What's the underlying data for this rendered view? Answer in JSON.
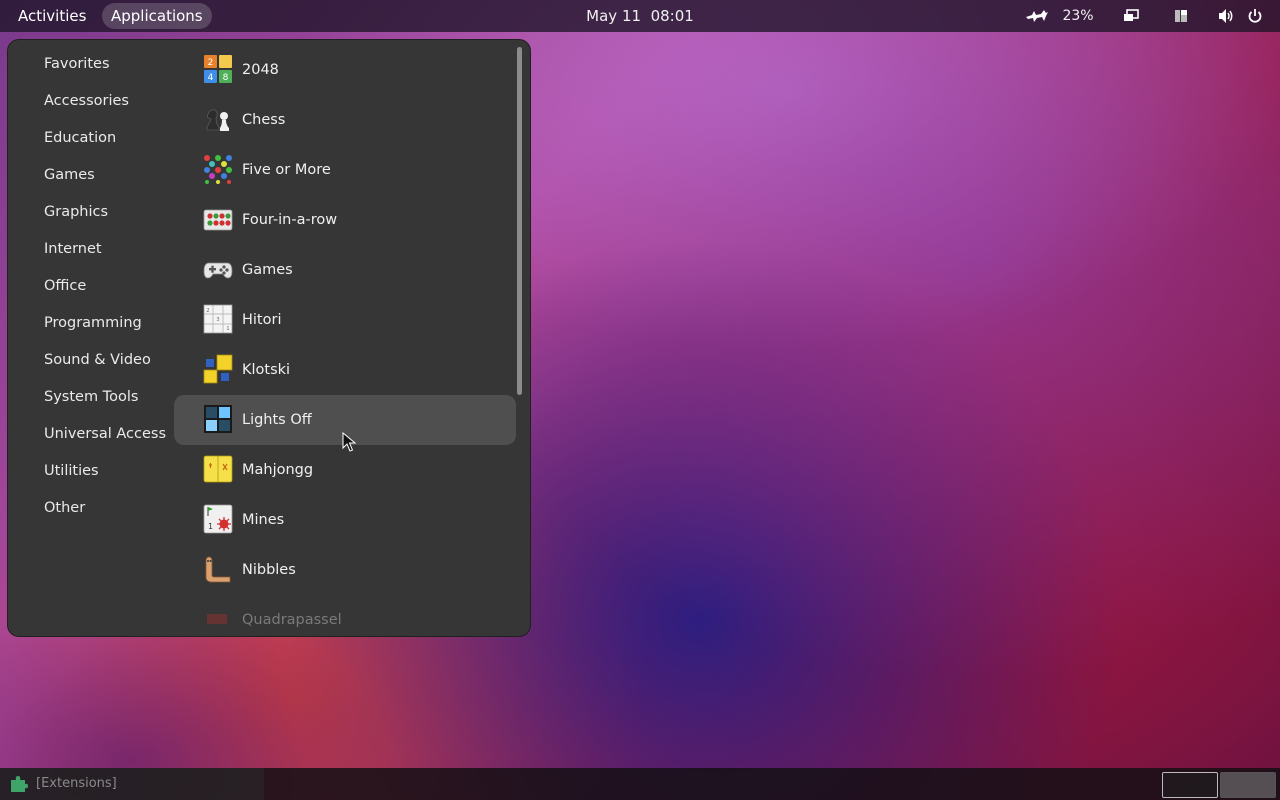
{
  "topbar": {
    "activities": "Activities",
    "applications": "Applications",
    "date": "May 11",
    "time": "08:01",
    "battery_percent": "23%",
    "icons": [
      "system-monitor-icon",
      "display-icon",
      "layout-icon",
      "volume-icon",
      "power-icon"
    ]
  },
  "menu": {
    "categories": [
      {
        "label": "Favorites"
      },
      {
        "label": "Accessories"
      },
      {
        "label": "Education"
      },
      {
        "label": "Games"
      },
      {
        "label": "Graphics"
      },
      {
        "label": "Internet"
      },
      {
        "label": "Office"
      },
      {
        "label": "Programming"
      },
      {
        "label": "Sound & Video"
      },
      {
        "label": "System Tools"
      },
      {
        "label": "Universal Access"
      },
      {
        "label": "Utilities"
      },
      {
        "label": "Other"
      }
    ],
    "apps": [
      {
        "label": "2048",
        "icon": "2048-icon"
      },
      {
        "label": "Chess",
        "icon": "chess-icon"
      },
      {
        "label": "Five or More",
        "icon": "five-or-more-icon"
      },
      {
        "label": "Four-in-a-row",
        "icon": "four-in-a-row-icon"
      },
      {
        "label": "Games",
        "icon": "gamepad-icon"
      },
      {
        "label": "Hitori",
        "icon": "hitori-icon"
      },
      {
        "label": "Klotski",
        "icon": "klotski-icon"
      },
      {
        "label": "Lights Off",
        "icon": "lights-off-icon",
        "hovered": true
      },
      {
        "label": "Mahjongg",
        "icon": "mahjongg-icon"
      },
      {
        "label": "Mines",
        "icon": "mines-icon"
      },
      {
        "label": "Nibbles",
        "icon": "nibbles-icon"
      },
      {
        "label": "Quadrapassel",
        "icon": "quadrapassel-icon"
      }
    ]
  },
  "bottombar": {
    "extensions_label": "[Extensions]"
  }
}
